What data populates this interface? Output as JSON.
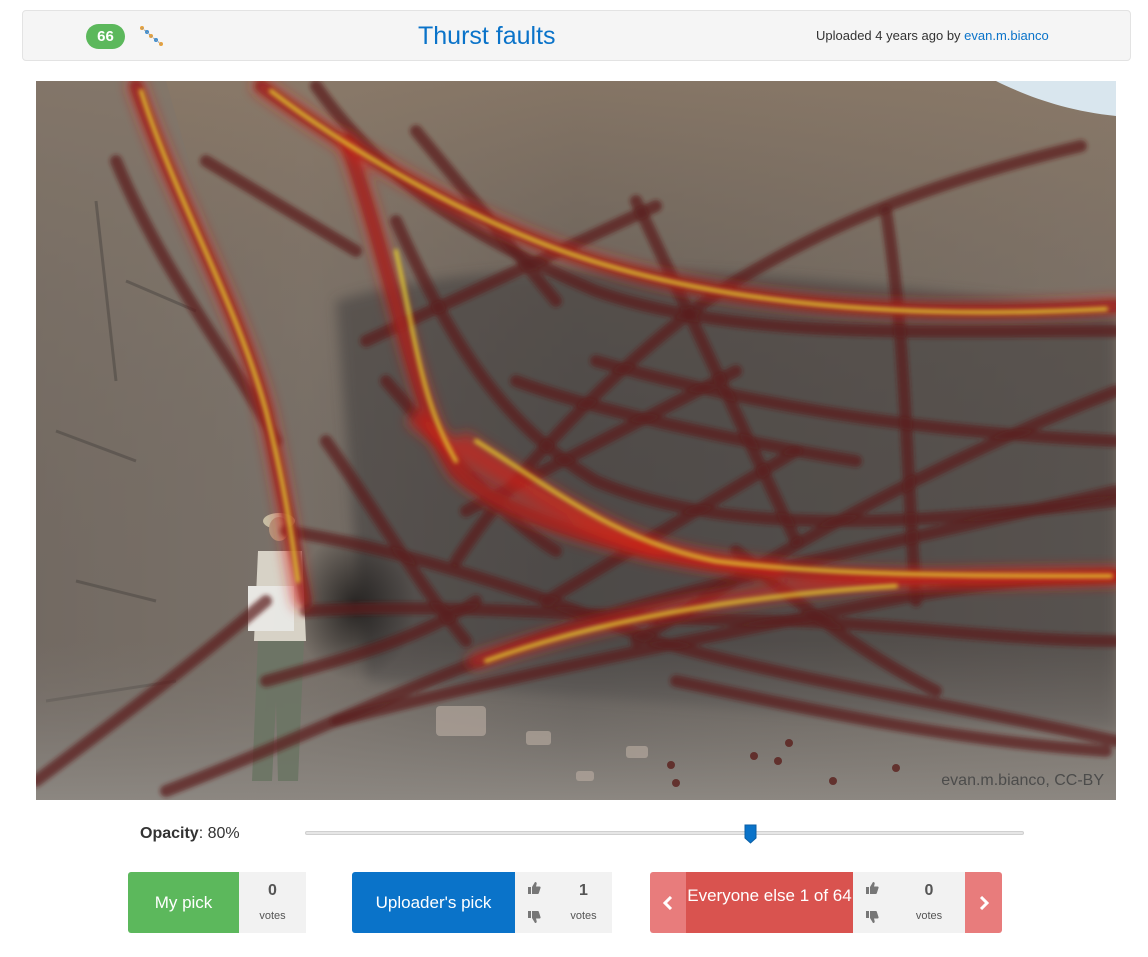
{
  "header": {
    "count_badge": "66",
    "title": "Thurst faults",
    "uploaded_text": "Uploaded 4 years ago by",
    "uploader": "evan.m.bianco"
  },
  "image": {
    "watermark": "evan.m.bianco, CC-BY",
    "colors": {
      "overlay_dark": "#5a1f1c",
      "overlay_red": "#d4231a",
      "overlay_yellow": "#e8d430"
    }
  },
  "opacity": {
    "label": "Opacity",
    "value": ": 80%",
    "level": 0.62
  },
  "picks": {
    "my_pick": {
      "label": "My pick",
      "votes": "0",
      "votes_label": "votes",
      "color": "#5cb85c"
    },
    "uploader_pick": {
      "label": "Uploader's pick",
      "votes": "1",
      "votes_label": "votes",
      "color": "#0a73c9"
    },
    "everyone_else": {
      "label": "Everyone else 1 of 64",
      "votes": "0",
      "votes_label": "votes",
      "color": "#d9534f"
    }
  },
  "icons": {
    "pick": "interpretation-line-icon",
    "thumb_up": "thumbs-up-icon",
    "thumb_down": "thumbs-down-icon",
    "prev": "chevron-left-icon",
    "next": "chevron-right-icon"
  }
}
